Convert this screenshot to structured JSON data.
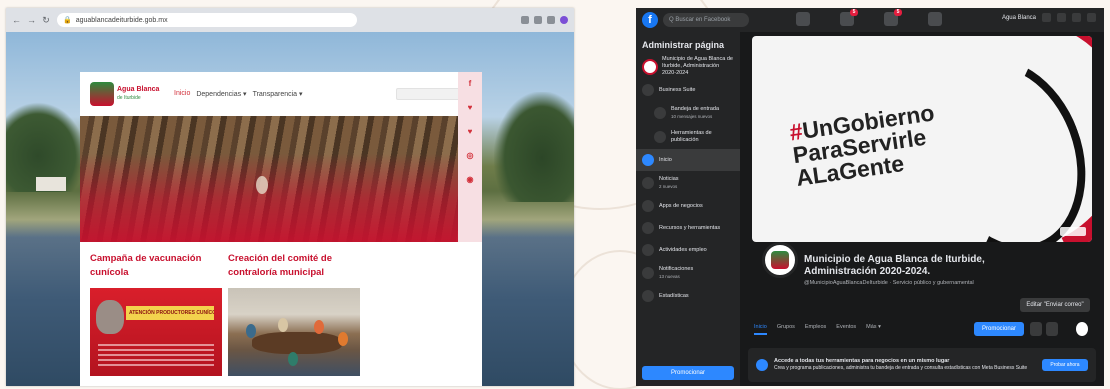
{
  "left_site": {
    "url": "aguablancadeiturbide.gob.mx",
    "logo": {
      "name": "Agua Blanca",
      "subtitle": "de Iturbide"
    },
    "menu": {
      "home": "Inicio",
      "dependencias": "Dependencias ▾",
      "transparencia": "Transparencia ▾"
    },
    "social_icons": [
      "f",
      "♥",
      "♥",
      "◎",
      "◉"
    ],
    "posts": [
      {
        "title": "Campaña de vacunación cunícola",
        "thumb_banner": "ATENCIÓN PRODUCTORES CUNÍCOLAS"
      },
      {
        "title": "Creación del comité de contraloría municipal"
      }
    ]
  },
  "right_fb": {
    "search_placeholder": "Q Buscar en Facebook",
    "nav_badges": [
      "",
      "5",
      "5",
      "",
      ""
    ],
    "user_label": "Agua Blanca",
    "sidebar": {
      "title": "Administrar página",
      "page_name": "Municipio de Agua Blanca de Iturbide, Administración 2020-2024",
      "business_suite": "Business Suite",
      "inbox": "Bandeja de entrada",
      "inbox_sub": "10 mensajes nuevos",
      "publishing_tools": "Herramientas de publicación",
      "home": "Inicio",
      "notices": "Noticias",
      "notices_sub": "2 nuevos",
      "ads": "Apps de negocios",
      "resources": "Recursos y herramientas",
      "services": "Actividades empleo",
      "notifications": "Notificaciones",
      "notifications_sub": "13 nuevas",
      "stats": "Estadísticas",
      "promote_button": "Promocionar"
    },
    "cover": {
      "hashtag": "#",
      "slogan": "UnGobierno\nParaServirle\nALaGente"
    },
    "page_title": "Municipio de Agua Blanca de Iturbide, Administración 2020-2024.",
    "page_subtitle": "@MunicipioAguaBlancaDeIturbide · Servicio público y gubernamental",
    "edit_button": "Editar \"Enviar correo\"",
    "tabs": [
      "Inicio",
      "Grupos",
      "Empleos",
      "Eventos",
      "Más ▾"
    ],
    "promote": "Promocionar",
    "banner": {
      "title": "Accede a todas tus herramientas para negocios en un mismo lugar",
      "text": "Crea y programa publicaciones, administra tu bandeja de entrada y consulta estadísticas con Meta Business Suite",
      "button": "Probar ahora"
    }
  }
}
